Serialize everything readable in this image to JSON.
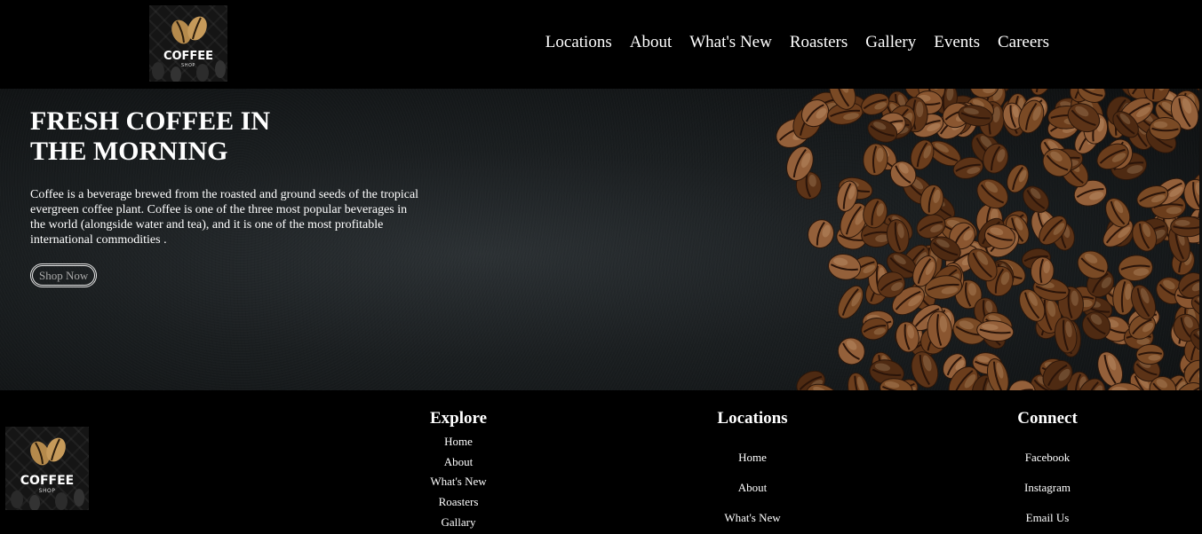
{
  "header": {
    "logo": {
      "brand": "COFFEE",
      "sub": "SHOP"
    },
    "nav": [
      "Locations",
      "About",
      "What's New",
      "Roasters",
      "Gallery",
      "Events",
      "Careers"
    ]
  },
  "hero": {
    "title": "FRESH COFFEE IN THE MORNING",
    "description": "Coffee is a beverage brewed from the roasted and ground seeds of the tropical evergreen coffee plant. Coffee is one of the three most popular beverages in the world (alongside water and tea), and it is one of the most profitable international commodities .",
    "button_label": "Shop Now"
  },
  "footer": {
    "logo": {
      "brand": "COFFEE",
      "sub": "SHOP"
    },
    "columns": [
      {
        "title": "Explore",
        "links": [
          "Home",
          "About",
          "What's New",
          "Roasters",
          "Gallary"
        ]
      },
      {
        "title": "Locations",
        "links": [
          "Home",
          "About",
          "What's New"
        ]
      },
      {
        "title": "Connect",
        "links": [
          "Facebook",
          "Instagram",
          "Email Us"
        ]
      }
    ]
  },
  "colors": {
    "background": "#000000",
    "text": "#ffffff",
    "bean": "#7a4a25"
  }
}
